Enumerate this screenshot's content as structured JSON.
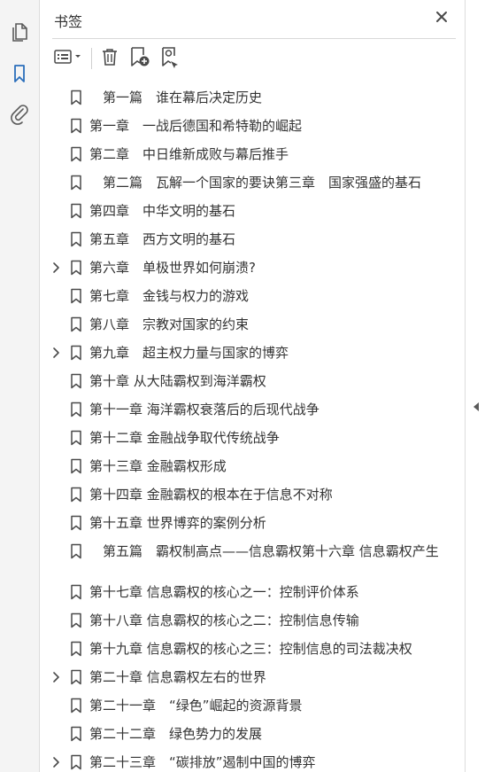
{
  "panel": {
    "title": "书签"
  },
  "bookmarks": [
    {
      "label": "　第一篇　谁在幕后决定历史",
      "expandable": false
    },
    {
      "label": "第一章　一战后德国和希特勒的崛起",
      "expandable": false
    },
    {
      "label": "第二章　中日维新成败与幕后推手",
      "expandable": false
    },
    {
      "label": "　第二篇　瓦解一个国家的要诀第三章　国家强盛的基石",
      "expandable": false
    },
    {
      "label": "第四章　中华文明的基石",
      "expandable": false
    },
    {
      "label": "第五章　西方文明的基石",
      "expandable": false
    },
    {
      "label": "第六章　单极世界如何崩溃?",
      "expandable": true
    },
    {
      "label": "第七章　金钱与权力的游戏",
      "expandable": false
    },
    {
      "label": "第八章　宗教对国家的约束",
      "expandable": false
    },
    {
      "label": "第九章　超主权力量与国家的博弈",
      "expandable": true
    },
    {
      "label": "第十章 从大陆霸权到海洋霸权",
      "expandable": false
    },
    {
      "label": "第十一章 海洋霸权衰落后的后现代战争",
      "expandable": false
    },
    {
      "label": "第十二章 金融战争取代传统战争",
      "expandable": false
    },
    {
      "label": "第十三章 金融霸权形成",
      "expandable": false
    },
    {
      "label": "第十四章 金融霸权的根本在于信息不对称",
      "expandable": false
    },
    {
      "label": "第十五章 世界博弈的案例分析",
      "expandable": false
    },
    {
      "label": "　第五篇　霸权制高点——信息霸权第十六章 信息霸权产生",
      "expandable": false,
      "two_line": true
    },
    {
      "label": "第十七章 信息霸权的核心之一：控制评价体系",
      "expandable": false
    },
    {
      "label": "第十八章 信息霸权的核心之二：控制信息传输",
      "expandable": false
    },
    {
      "label": "第十九章 信息霸权的核心之三：控制信息的司法裁决权",
      "expandable": false
    },
    {
      "label": "第二十章 信息霸权左右的世界",
      "expandable": true
    },
    {
      "label": "第二十一章　“绿色”崛起的资源背景",
      "expandable": false
    },
    {
      "label": "第二十二章　绿色势力的发展",
      "expandable": false
    },
    {
      "label": "第二十三章　“碳排放”遏制中国的博弈",
      "expandable": true
    }
  ],
  "icons": {
    "rail": [
      "pages-icon",
      "bookmarks-icon",
      "attachments-icon"
    ],
    "toolbar": [
      "options-menu-icon",
      "delete-icon",
      "new-bookmark-icon",
      "find-bookmark-icon"
    ]
  },
  "colors": {
    "accent": "#2a6ebb",
    "icon": "#5a5a5a",
    "text": "#333333"
  }
}
